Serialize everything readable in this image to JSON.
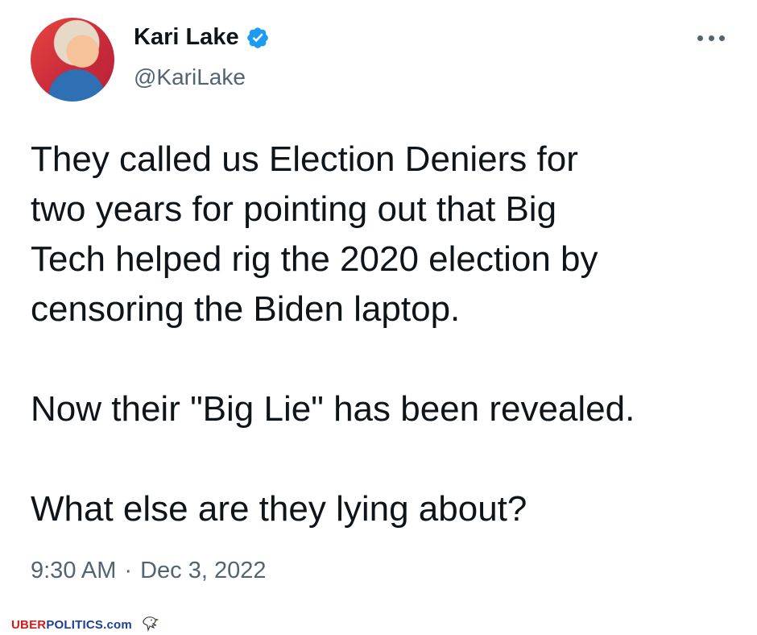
{
  "author": {
    "name": "Kari Lake",
    "handle": "@KariLake"
  },
  "tweet": {
    "paragraph_1_line_1": "They called us Election Deniers for",
    "paragraph_1_line_2": "two years for pointing out that Big",
    "paragraph_1_line_3": "Tech helped rig the 2020 election by",
    "paragraph_1_line_4": "censoring the Biden laptop.",
    "paragraph_2": "Now their \"Big Lie\" has been revealed.",
    "paragraph_3": "What else are they lying about?"
  },
  "meta": {
    "time": "9:30 AM",
    "separator": "·",
    "date": "Dec 3, 2022"
  },
  "watermark": {
    "part_red": "UBER",
    "part_blue": "POLITICS",
    "part_domain": ".com"
  },
  "icons": [
    "verified-badge-icon",
    "more-options-icon",
    "eagle-icon"
  ],
  "colors": {
    "text_primary": "#0f1419",
    "text_secondary": "#536471",
    "verified_blue": "#1d9bf0"
  }
}
